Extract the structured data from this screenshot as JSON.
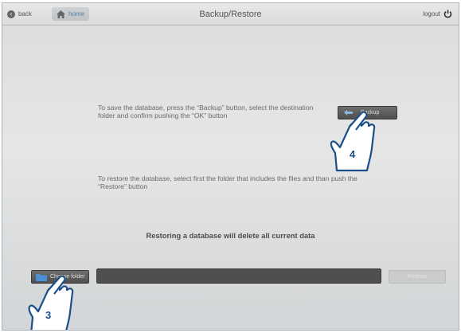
{
  "topbar": {
    "back_label": "back",
    "home_label": "home",
    "title": "Backup/Restore",
    "logout_label": "logout"
  },
  "instructions": {
    "backup": "To save the database, press the “Backup” button, select the destination folder and confirm pushing the “OK” button",
    "restore": "To restore the database, select first the folder that includes the files and than push the “Restore” button",
    "warning": "Restoring a database will delete all current data"
  },
  "buttons": {
    "backup_label": "Backup",
    "choose_folder_label": "Choose folder",
    "restore_label": "Restore"
  },
  "path_field": {
    "value": ""
  },
  "callouts": {
    "backup_step": "4",
    "choose_step": "3"
  },
  "colors": {
    "accent_blue": "#1b4f8a",
    "dark_button": "#5a5a5a",
    "folder_icon": "#4a90d9"
  }
}
